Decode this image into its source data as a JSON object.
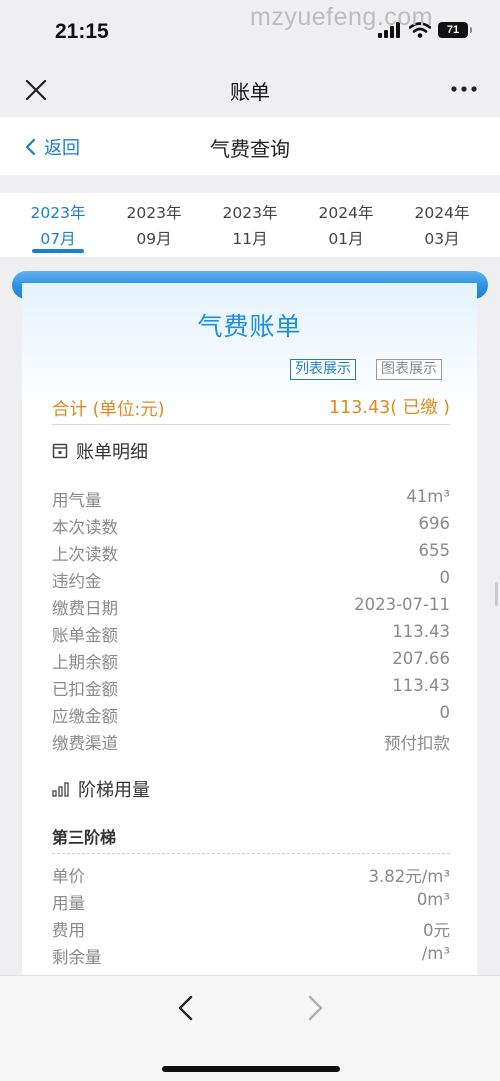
{
  "status_bar": {
    "time": "21:15",
    "battery": "71"
  },
  "watermark": "mzyuefeng.com",
  "nav": {
    "title": "账单"
  },
  "header": {
    "back_label": "返回",
    "title": "气费查询"
  },
  "tabs": [
    {
      "year": "2023年",
      "month": "07月",
      "active": true
    },
    {
      "year": "2023年",
      "month": "09月",
      "active": false
    },
    {
      "year": "2023年",
      "month": "11月",
      "active": false
    },
    {
      "year": "2024年",
      "month": "01月",
      "active": false
    },
    {
      "year": "2024年",
      "month": "03月",
      "active": false
    }
  ],
  "card": {
    "title": "气费账单",
    "view_list": "列表展示",
    "view_chart": "图表展示",
    "total_label": "合计 (单位:元)",
    "total_value": "113.43( 已缴 )"
  },
  "details": {
    "title": "账单明细",
    "rows": [
      {
        "label": "用气量",
        "value": "41m³"
      },
      {
        "label": "本次读数",
        "value": "696"
      },
      {
        "label": "上次读数",
        "value": "655"
      },
      {
        "label": "违约金",
        "value": "0"
      },
      {
        "label": "缴费日期",
        "value": "2023-07-11"
      },
      {
        "label": "账单金额",
        "value": "113.43"
      },
      {
        "label": "上期余额",
        "value": "207.66"
      },
      {
        "label": "已扣金额",
        "value": "113.43"
      },
      {
        "label": "应缴金额",
        "value": "0"
      },
      {
        "label": "缴费渠道",
        "value": "预付扣款"
      }
    ]
  },
  "tiers": {
    "title": "阶梯用量",
    "tier_title": "第三阶梯",
    "rows": [
      {
        "label": "单价",
        "value": "3.82元/m³"
      },
      {
        "label": "用量",
        "value": "0m³"
      },
      {
        "label": "费用",
        "value": "0元"
      },
      {
        "label": "剩余量",
        "value": "/m³"
      }
    ]
  },
  "colors": {
    "accent": "#1a7fd0",
    "total": "#e08a1e",
    "roll": "#2c8fe3"
  }
}
